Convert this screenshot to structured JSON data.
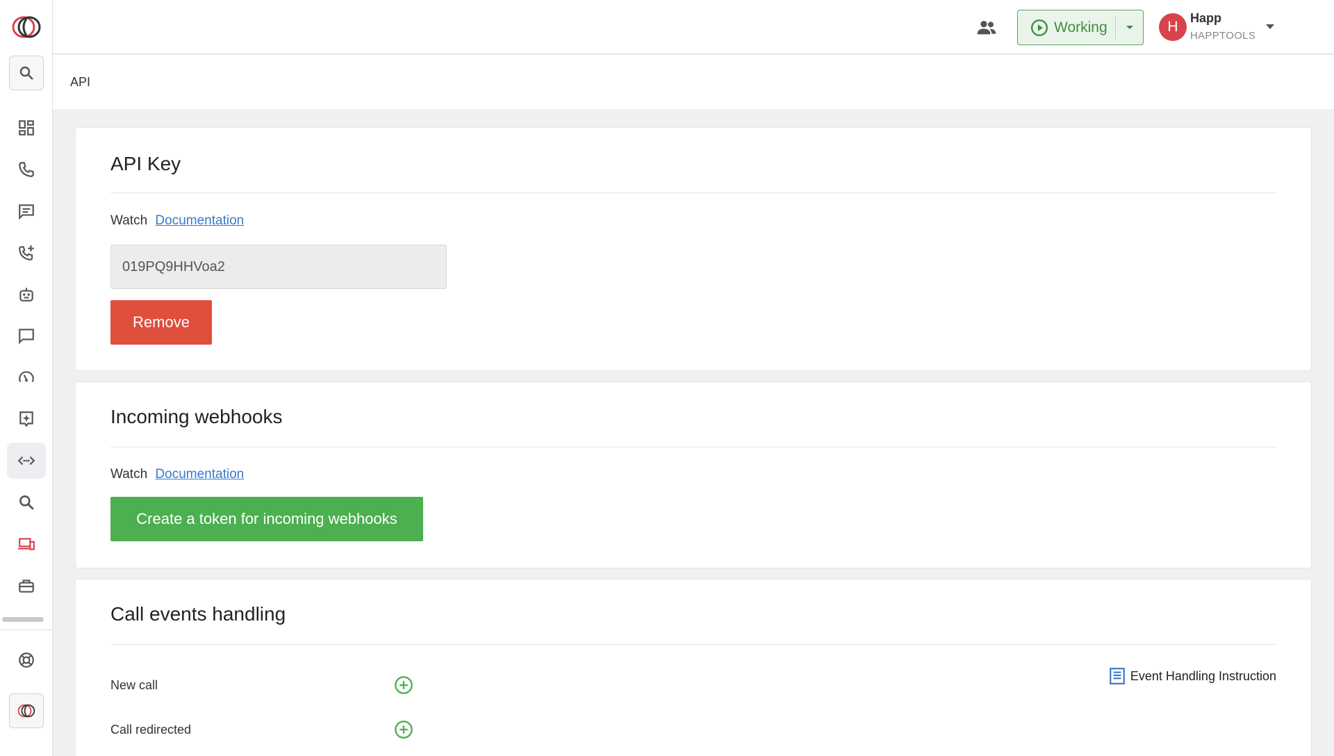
{
  "header": {
    "status_label": "Working",
    "avatar_letter": "H",
    "user_name": "Happ",
    "user_company": "HAPPTOOLS"
  },
  "breadcrumb": "API",
  "api_key_section": {
    "title": "API Key",
    "watch_label": "Watch",
    "doc_link": "Documentation",
    "key_value": "019PQ9HHVoa2",
    "remove_label": "Remove"
  },
  "webhooks_section": {
    "title": "Incoming webhooks",
    "watch_label": "Watch",
    "doc_link": "Documentation",
    "create_label": "Create a token for incoming webhooks"
  },
  "call_events_section": {
    "title": "Call events handling",
    "instruction_label": "Event Handling Instruction",
    "events": [
      {
        "label": "New call"
      },
      {
        "label": "Call redirected"
      }
    ]
  },
  "sidebar": {
    "items": [
      {
        "icon": "dashboard-icon"
      },
      {
        "icon": "phone-icon"
      },
      {
        "icon": "chat-icon"
      },
      {
        "icon": "phone-add-icon"
      },
      {
        "icon": "robot-icon"
      },
      {
        "icon": "message-icon"
      },
      {
        "icon": "speedometer-icon"
      },
      {
        "icon": "spark-icon"
      },
      {
        "icon": "api-icon"
      },
      {
        "icon": "search-icon"
      },
      {
        "icon": "devices-icon"
      },
      {
        "icon": "toolbox-icon"
      }
    ],
    "active_index": 8
  },
  "colors": {
    "accent_green": "#4caf50",
    "danger_red": "#e04e3c",
    "link_blue": "#3779c9",
    "avatar_red": "#d9434b"
  }
}
